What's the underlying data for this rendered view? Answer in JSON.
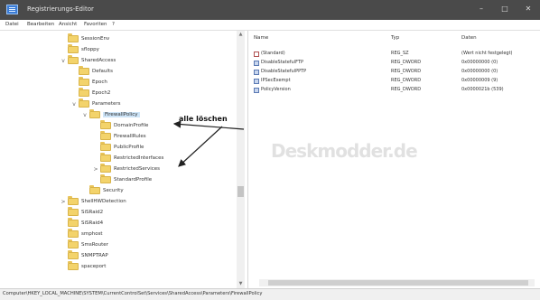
{
  "window": {
    "title": "Registrierungs-Editor",
    "controls": [
      "–",
      "□",
      "✕"
    ]
  },
  "menu": [
    "Datei",
    "Bearbeiten",
    "Ansicht",
    "Favoriten",
    "?"
  ],
  "tree": [
    {
      "label": "SessionEnv",
      "exp": ""
    },
    {
      "label": "sfloppy",
      "exp": ""
    },
    {
      "label": "SharedAccess",
      "exp": "v"
    },
    {
      "label": "Defaults",
      "exp": ""
    },
    {
      "label": "Epoch",
      "exp": ""
    },
    {
      "label": "Epoch2",
      "exp": ""
    },
    {
      "label": "Parameters",
      "exp": "v"
    },
    {
      "label": "FirewallPolicy",
      "exp": "v"
    },
    {
      "label": "DomainProfile",
      "exp": ""
    },
    {
      "label": "FirewallRules",
      "exp": ""
    },
    {
      "label": "PublicProfile",
      "exp": ""
    },
    {
      "label": "RestrictedInterfaces",
      "exp": ""
    },
    {
      "label": "RestrictedServices",
      "exp": ">"
    },
    {
      "label": "StandardProfile",
      "exp": ""
    },
    {
      "label": "Security",
      "exp": ""
    },
    {
      "label": "ShellHWDetection",
      "exp": ">"
    },
    {
      "label": "SiSRaid2",
      "exp": ""
    },
    {
      "label": "SiSRaid4",
      "exp": ""
    },
    {
      "label": "smphost",
      "exp": ""
    },
    {
      "label": "SmsRouter",
      "exp": ""
    },
    {
      "label": "SNMPTRAP",
      "exp": ""
    },
    {
      "label": "spaceport",
      "exp": ""
    }
  ],
  "list": {
    "headers": {
      "name": "Name",
      "type": "Typ",
      "data": "Daten"
    },
    "rows": [
      {
        "name": "(Standard)",
        "type": "REG_SZ",
        "data": "(Wert nicht festgelegt)",
        "icon": "string-value-icon"
      },
      {
        "name": "DisableStatefulFTP",
        "type": "REG_DWORD",
        "data": "0x00000000 (0)",
        "icon": "dword-value-icon"
      },
      {
        "name": "DisableStatefulPPTP",
        "type": "REG_DWORD",
        "data": "0x00000000 (0)",
        "icon": "dword-value-icon"
      },
      {
        "name": "IPSecExempt",
        "type": "REG_DWORD",
        "data": "0x00000009 (9)",
        "icon": "dword-value-icon"
      },
      {
        "name": "PolicyVersion",
        "type": "REG_DWORD",
        "data": "0x0000021b (539)",
        "icon": "dword-value-icon"
      }
    ]
  },
  "annotation": {
    "text": "alle löschen"
  },
  "watermark": {
    "text": "Deskmodder.de"
  },
  "status": {
    "path": "Computer\\HKEY_LOCAL_MACHINE\\SYSTEM\\CurrentControlSet\\Services\\SharedAccess\\Parameters\\FirewallPolicy"
  },
  "colors": {
    "titlebar": "#4a4a4a",
    "folder": "#f3d36b",
    "selection": "#cde4f7",
    "arrow": "#222222"
  }
}
